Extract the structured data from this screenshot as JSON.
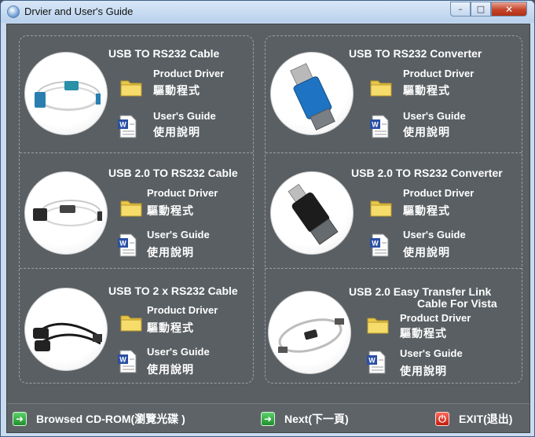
{
  "window": {
    "title": "Drvier and User's Guide",
    "buttons": {
      "minimize": "–",
      "maximize": "□",
      "close": "✕"
    }
  },
  "products": [
    {
      "title": "USB  TO RS232 Cable",
      "driver_en": "Product Driver",
      "driver_zh": "驅動程式",
      "guide_en": "User's Guide",
      "guide_zh": "使用說明",
      "image": "usb-rs232-cable-photo"
    },
    {
      "title": "USB  TO RS232 Converter",
      "driver_en": "Product Driver",
      "driver_zh": "驅動程式",
      "guide_en": "User's Guide",
      "guide_zh": "使用說明",
      "image": "usb-rs232-converter-photo"
    },
    {
      "title": "USB 2.0 TO RS232 Cable",
      "driver_en": "Product Driver",
      "driver_zh": "驅動程式",
      "guide_en": "User's Guide",
      "guide_zh": "使用說明",
      "image": "usb2-rs232-cable-photo"
    },
    {
      "title": "USB 2.0 TO RS232  Converter",
      "driver_en": "Product Driver",
      "driver_zh": "驅動程式",
      "guide_en": "User's Guide",
      "guide_zh": "使用說明",
      "image": "usb2-rs232-converter-photo"
    },
    {
      "title": "USB TO 2 x RS232 Cable",
      "driver_en": "Product Driver",
      "driver_zh": "驅動程式",
      "guide_en": "User's Guide",
      "guide_zh": "使用說明",
      "image": "usb-2x-rs232-cable-photo"
    },
    {
      "title_line1": "USB 2.0 Easy Transfer Link",
      "title_line2": "Cable For Vista",
      "driver_en": "Product Driver",
      "driver_zh": "驅動程式",
      "guide_en": "User's Guide",
      "guide_zh": "使用說明",
      "image": "easy-transfer-link-cable-photo"
    }
  ],
  "footer": {
    "browse_label": "Browsed CD-ROM(瀏覽光碟 )",
    "next_label": "Next(下一頁)",
    "exit_label": "EXIT(退出)",
    "browse_icon": "green-arrow-icon",
    "next_icon": "green-arrow-icon",
    "exit_icon": "red-power-icon"
  },
  "colors": {
    "background": "#595f63",
    "text": "#ffffff",
    "green": "#1f8f2d",
    "red": "#c21a0c"
  }
}
